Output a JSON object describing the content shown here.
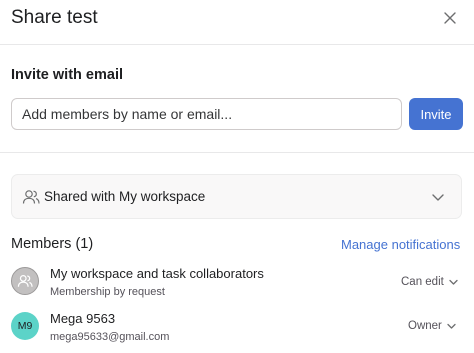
{
  "dialog": {
    "title": "Share test"
  },
  "invite": {
    "section_label": "Invite with email",
    "placeholder": "Add members by name or email...",
    "value": "",
    "button_label": "Invite"
  },
  "access": {
    "label": "Shared with My workspace"
  },
  "members": {
    "title": "Members (1)",
    "manage_link": "Manage notifications",
    "items": [
      {
        "name": "My workspace and task collaborators",
        "subtitle": "Membership by request",
        "role": "Can edit",
        "avatar_icon": "people-icon"
      },
      {
        "name": "Mega 9563",
        "subtitle": "mega95633@gmail.com",
        "role": "Owner",
        "initials": "M9"
      }
    ]
  },
  "colors": {
    "accent": "#4573d2",
    "avatar_teal": "#5cd3c8",
    "avatar_gray": "#c2c0c0"
  }
}
